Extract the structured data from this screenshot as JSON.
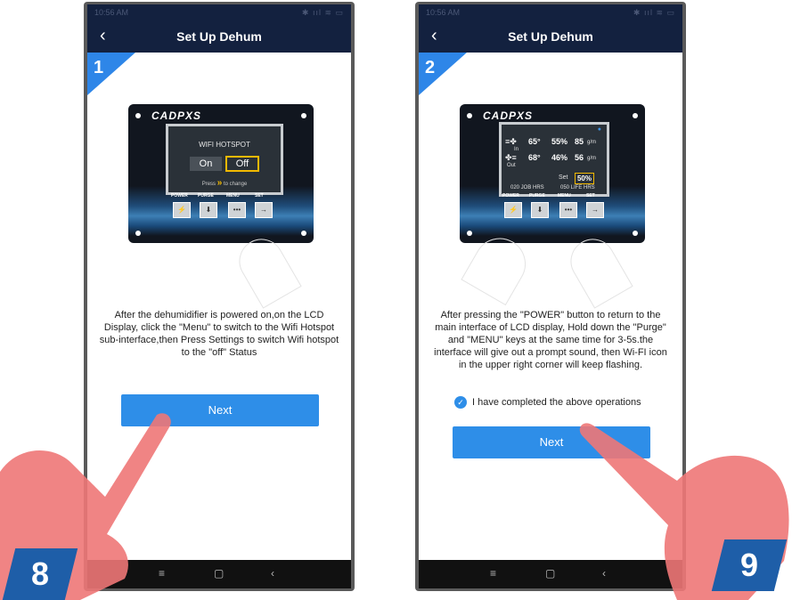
{
  "status": {
    "time": "10:56 AM",
    "icons": "✱ ııl ≋ ▭"
  },
  "nav": {
    "title": "Set Up Dehum",
    "back": "‹"
  },
  "step1": {
    "number": "1",
    "brand": "CADPXS",
    "lcd_title": "WIFI HOTSPOT",
    "on": "On",
    "off": "Off",
    "press": "Press",
    "to_change": "to change",
    "buttons": [
      "POWER",
      "PURGE",
      "MENU",
      "SET"
    ],
    "description": "After the dehumidifier is powered on,on the LCD Display, click the \"Menu\" to switch to the Wifi Hotspot sub-interface,then Press Settings to switch Wifi hotspot to the \"off\" Status",
    "next": "Next"
  },
  "step2": {
    "number": "2",
    "brand": "CADPXS",
    "in_temp": "65°",
    "in_hum": "55%",
    "in_val": "85",
    "in_unit": "g/m",
    "out_temp": "68°",
    "out_hum": "46%",
    "out_val": "56",
    "out_unit": "g/m",
    "in_label": "In",
    "out_label": "Out",
    "set": "Set",
    "set_value": "50%",
    "job_hrs": "020 JOB HRS",
    "life_hrs": "050 LIFE HRS",
    "buttons": [
      "POWER",
      "PURGE",
      "MENU",
      "SET"
    ],
    "description": "After pressing the \"POWER\" button to return to the main interface of LCD display, Hold down the \"Purge\" and \"MENU\" keys at the same time for 3-5s.the interface will give out a prompt sound, then Wi-FI icon in the upper right corner will keep flashing.",
    "checkbox_label": "I have completed the above operations",
    "next": "Next"
  },
  "bottom_nav": {
    "menu": "≡",
    "home": "▢",
    "back": "‹"
  },
  "badges": {
    "left": "8",
    "right": "9"
  },
  "colors": {
    "navy": "#13213f",
    "accent": "#2e8ee8",
    "badge": "#1e5ea8",
    "hand": "#ee7777"
  }
}
